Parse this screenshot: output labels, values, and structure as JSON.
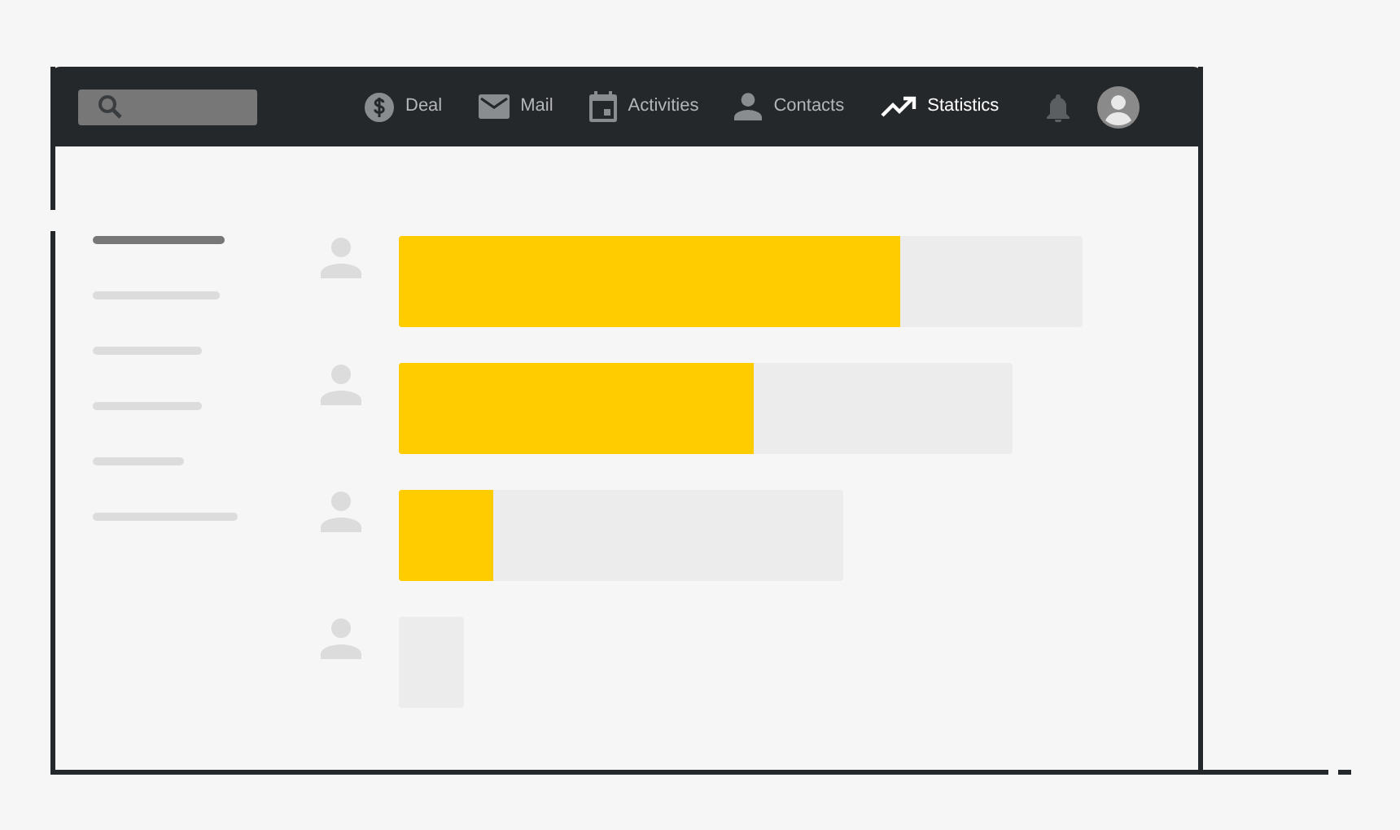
{
  "nav": [
    {
      "label": "Deal",
      "selected": false
    },
    {
      "label": "Mail",
      "selected": false
    },
    {
      "label": "Activities",
      "selected": false
    },
    {
      "label": "Contacts",
      "selected": false
    },
    {
      "label": "Statistics",
      "selected": true
    }
  ],
  "sidebar": {
    "items": [
      {
        "selected": true
      },
      {
        "selected": false
      },
      {
        "selected": false
      },
      {
        "selected": false
      },
      {
        "selected": false
      },
      {
        "selected": false
      }
    ]
  },
  "rows": [
    {
      "level": 0.733
    },
    {
      "level": 0.578
    },
    {
      "level": 0.212
    },
    {}
  ]
}
